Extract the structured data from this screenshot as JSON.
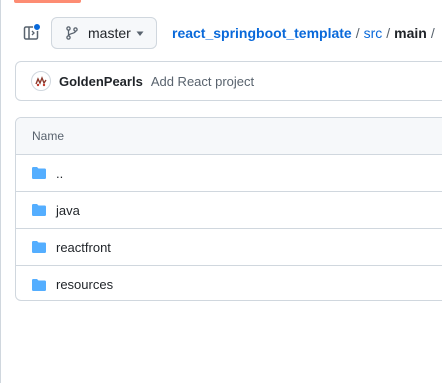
{
  "toolbar": {
    "branch_name": "master",
    "sidebar_icon": "sidebar-expand-icon",
    "branch_icon": "git-branch-icon",
    "caret_icon": "triangle-down-icon",
    "notification_color": "#0969da"
  },
  "breadcrumb": {
    "repo": "react_springboot_template",
    "separator": "/",
    "segments": [
      "src"
    ],
    "current": "main",
    "trailing": "/"
  },
  "commit": {
    "author": "GoldenPearls",
    "message": "Add React project",
    "avatar_icon": "user-avatar-icon"
  },
  "file_table": {
    "header": "Name",
    "rows": [
      {
        "name": "..",
        "icon": "folder-icon"
      },
      {
        "name": "java",
        "icon": "folder-icon"
      },
      {
        "name": "reactfront",
        "icon": "folder-icon"
      },
      {
        "name": "resources",
        "icon": "folder-icon"
      }
    ]
  },
  "colors": {
    "link": "#0969da",
    "folder": "#54aeff",
    "accent_tab": "#fd8c73",
    "border": "#d0d7de"
  }
}
